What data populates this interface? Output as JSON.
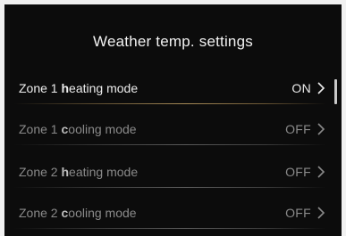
{
  "title": "Weather temp. settings",
  "rows": [
    {
      "prefix": "Zone 1 ",
      "bold": "h",
      "suffix": "eating mode",
      "value": "ON",
      "state": "active"
    },
    {
      "prefix": "Zone 1 ",
      "bold": "c",
      "suffix": "ooling mode",
      "value": "OFF",
      "state": "inactive"
    },
    {
      "prefix": "Zone 2 ",
      "bold": "h",
      "suffix": "eating mode",
      "value": "OFF",
      "state": "inactive"
    },
    {
      "prefix": "Zone 2 ",
      "bold": "c",
      "suffix": "ooling mode",
      "value": "OFF",
      "state": "inactive"
    }
  ],
  "icons": {
    "row_arrow": "chevron-right-icon"
  },
  "colors": {
    "background": "#0c0c0c",
    "accent_divider": "#a78b57",
    "active_text": "#ededed",
    "inactive_text": "#8a8a8a"
  }
}
